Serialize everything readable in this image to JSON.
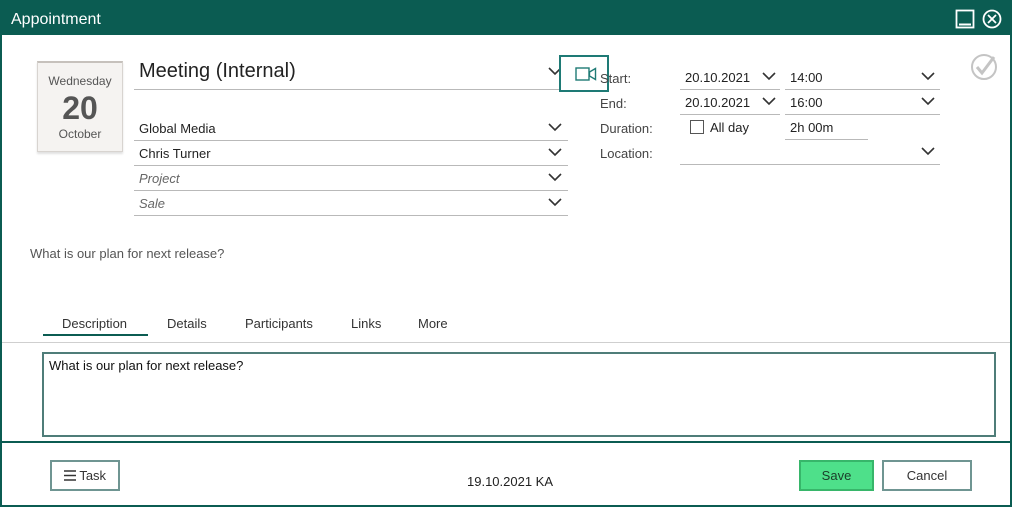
{
  "window": {
    "title": "Appointment"
  },
  "date_card": {
    "weekday": "Wednesday",
    "day": "20",
    "month": "October"
  },
  "subject": {
    "value": "Meeting (Internal)"
  },
  "fields": {
    "company": "Global Media",
    "contact": "Chris Turner",
    "project_placeholder": "Project",
    "sale_placeholder": "Sale"
  },
  "schedule": {
    "start_label": "Start:",
    "start_date": "20.10.2021",
    "start_time": "14:00",
    "end_label": "End:",
    "end_date": "20.10.2021",
    "end_time": "16:00",
    "duration_label": "Duration:",
    "all_day_label": "All day",
    "all_day_checked": false,
    "duration_value": "2h 00m",
    "location_label": "Location:",
    "location_value": ""
  },
  "subject_preview": "What is our plan for next release?",
  "tabs": [
    {
      "label": "Description",
      "active": true
    },
    {
      "label": "Details",
      "active": false
    },
    {
      "label": "Participants",
      "active": false
    },
    {
      "label": "Links",
      "active": false
    },
    {
      "label": "More",
      "active": false
    }
  ],
  "description": {
    "text": "What is our plan for next release?"
  },
  "footer": {
    "task_label": "Task",
    "info": "19.10.2021 KA",
    "save_label": "Save",
    "cancel_label": "Cancel"
  },
  "icons": {
    "minimize": "minimize-icon",
    "close": "close-icon",
    "video": "video-camera-icon",
    "done": "checkmark-circle-icon",
    "chevron": "chevron-down-icon",
    "menu": "hamburger-icon"
  },
  "colors": {
    "titlebar": "#0b5c52",
    "accent": "#1e7a75",
    "save": "#4ee08a"
  }
}
